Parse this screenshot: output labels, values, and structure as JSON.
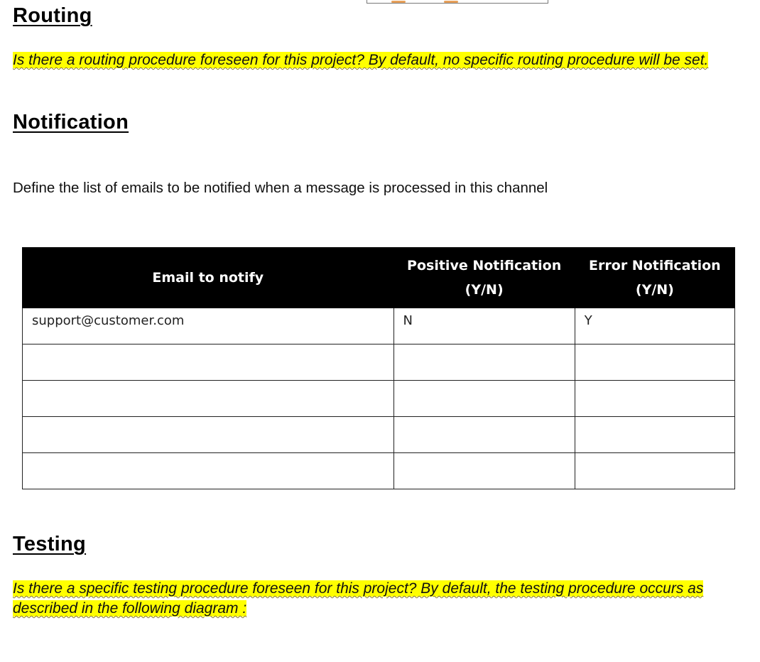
{
  "routing": {
    "heading": "Routing",
    "paragraph": "Is there a routing procedure foreseen for this project? By default, no specific routing procedure will be set."
  },
  "notification": {
    "heading": "Notification",
    "description": "Define the list of emails to be notified when a message is processed in this channel",
    "table": {
      "headers": {
        "email": "Email to notify",
        "positive_line1": "Positive Notification",
        "positive_line2": "(Y/N)",
        "error_line1": "Error Notification",
        "error_line2": "(Y/N)"
      },
      "rows": [
        {
          "email": "support@customer.com",
          "positive": "N",
          "error": "Y"
        },
        {
          "email": "",
          "positive": "",
          "error": ""
        },
        {
          "email": "",
          "positive": "",
          "error": ""
        },
        {
          "email": "",
          "positive": "",
          "error": ""
        },
        {
          "email": "",
          "positive": "",
          "error": ""
        }
      ]
    }
  },
  "testing": {
    "heading": "Testing",
    "paragraph": "Is there a specific testing procedure foreseen for this project? By default, the testing procedure occurs as described in the following diagram :"
  },
  "colors": {
    "highlight": "#ffff00",
    "table_header_bg": "#000000",
    "table_header_text": "#ffffff"
  },
  "icons": {
    "cursor": "text-cursor-icon"
  }
}
